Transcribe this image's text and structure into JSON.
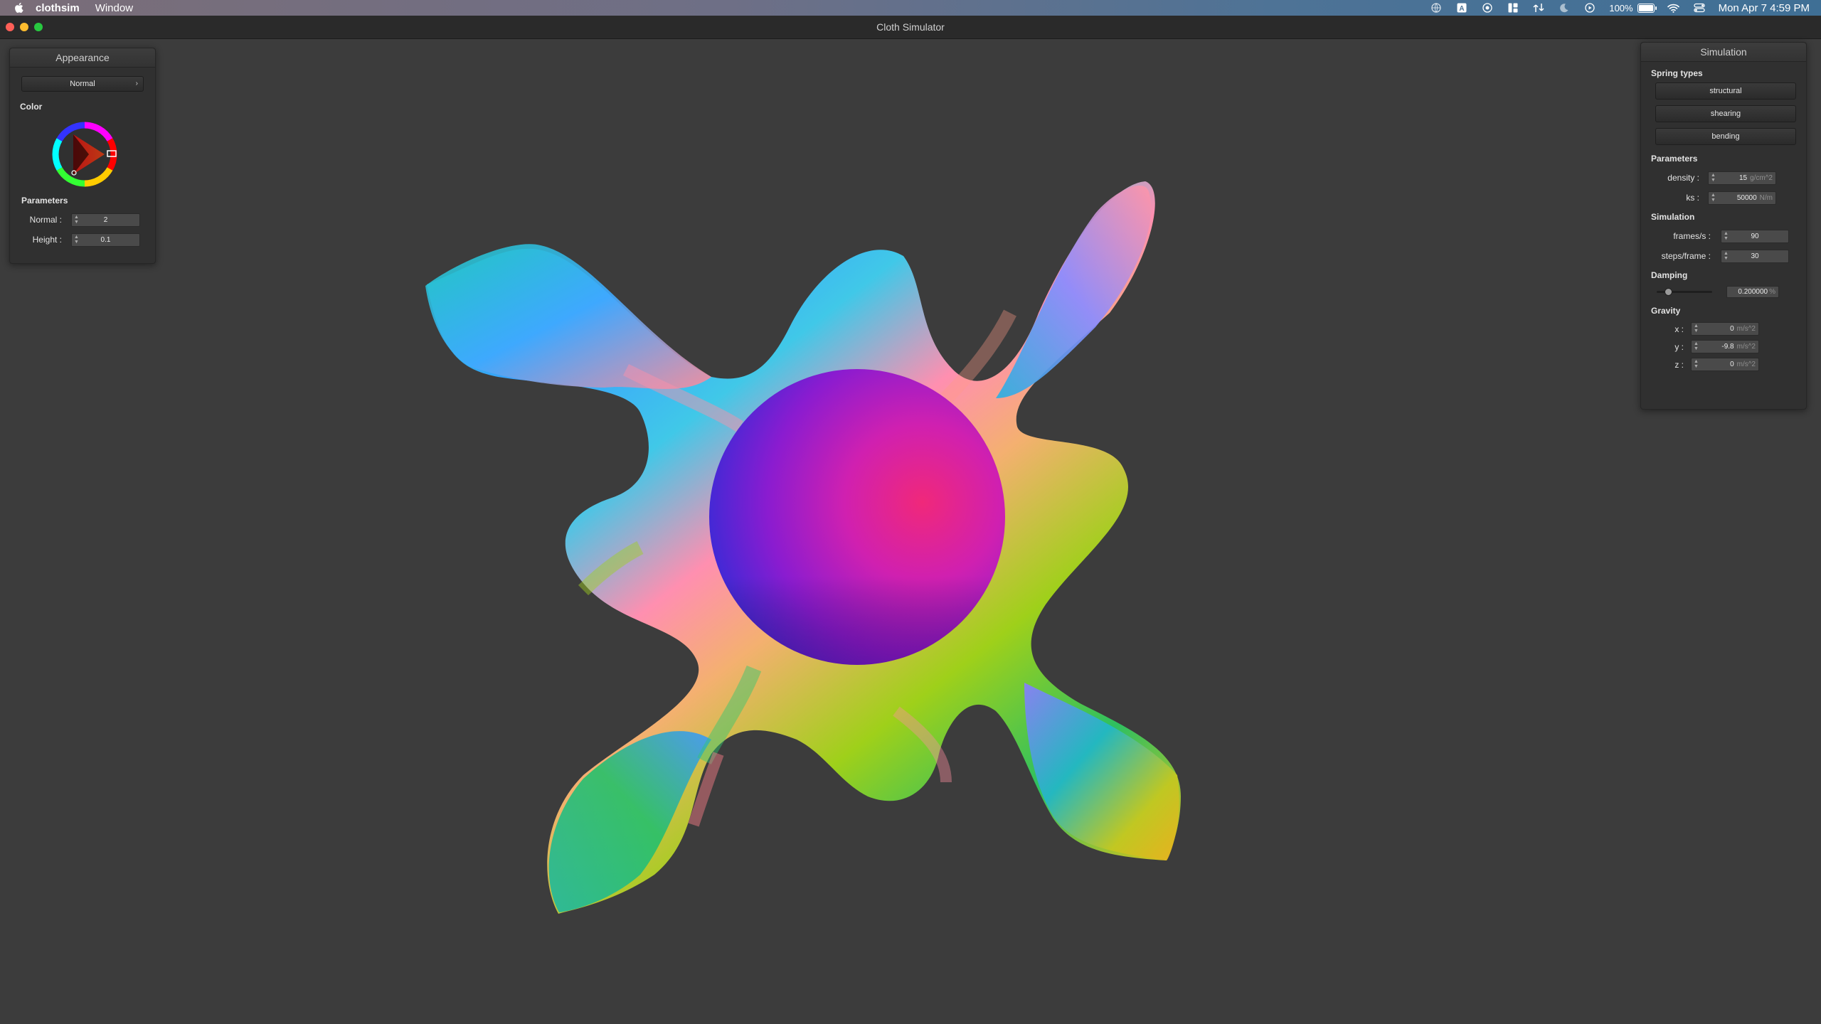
{
  "menubar": {
    "app_name": "clothsim",
    "menus": [
      "Window"
    ],
    "battery_text": "100%",
    "battery_level": 1.0,
    "datetime": "Mon Apr 7  4:59 PM"
  },
  "window": {
    "title": "Cloth Simulator"
  },
  "appearance": {
    "title": "Appearance",
    "shader_label": "Normal",
    "color_label": "Color",
    "params_label": "Parameters",
    "normal_label": "Normal :",
    "normal_value": "2",
    "height_label": "Height :",
    "height_value": "0.1"
  },
  "simulation": {
    "title": "Simulation",
    "spring_label": "Spring types",
    "springs": [
      "structural",
      "shearing",
      "bending"
    ],
    "params_label": "Parameters",
    "density_label": "density :",
    "density_value": "15",
    "density_unit": "g/cm^2",
    "ks_label": "ks :",
    "ks_value": "50000",
    "ks_unit": "N/m",
    "sim_label": "Simulation",
    "fps_label": "frames/s :",
    "fps_value": "90",
    "steps_label": "steps/frame :",
    "steps_value": "30",
    "damping_label": "Damping",
    "damping_value": "0.200000",
    "damping_unit": "%",
    "damping_level": 0.2,
    "gravity_label": "Gravity",
    "gx_label": "x :",
    "gx_value": "0",
    "gy_label": "y :",
    "gy_value": "-9.8",
    "gz_label": "z :",
    "gz_value": "0",
    "gravity_unit": "m/s^2"
  },
  "colors": {
    "background": "#3c3c3c",
    "panel": "#303030",
    "sphere_left": "#3a2bd0",
    "sphere_right": "#e0248c"
  }
}
